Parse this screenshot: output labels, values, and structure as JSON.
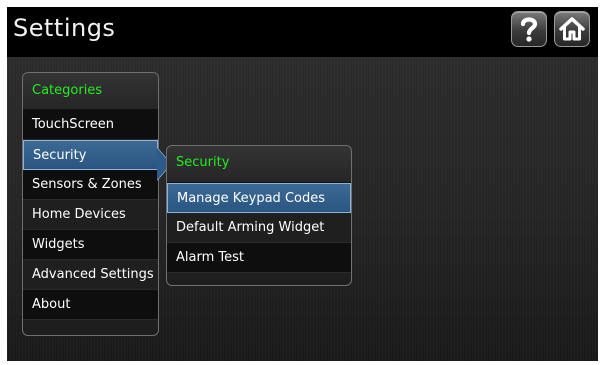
{
  "header": {
    "title": "Settings"
  },
  "icons": {
    "help": "question-mark-icon",
    "home": "home-icon"
  },
  "colors": {
    "accent_green": "#22ee22",
    "selection_blue": "#2d5a86",
    "text": "#ffffff"
  },
  "categories": {
    "header": "Categories",
    "items": [
      {
        "label": "TouchScreen"
      },
      {
        "label": "Security",
        "selected": true
      },
      {
        "label": "Sensors & Zones"
      },
      {
        "label": "Home Devices"
      },
      {
        "label": "Widgets"
      },
      {
        "label": "Advanced Settings"
      },
      {
        "label": "About"
      }
    ]
  },
  "submenu": {
    "header": "Security",
    "items": [
      {
        "label": "Manage Keypad Codes",
        "selected": true
      },
      {
        "label": "Default Arming Widget"
      },
      {
        "label": "Alarm Test"
      }
    ]
  }
}
